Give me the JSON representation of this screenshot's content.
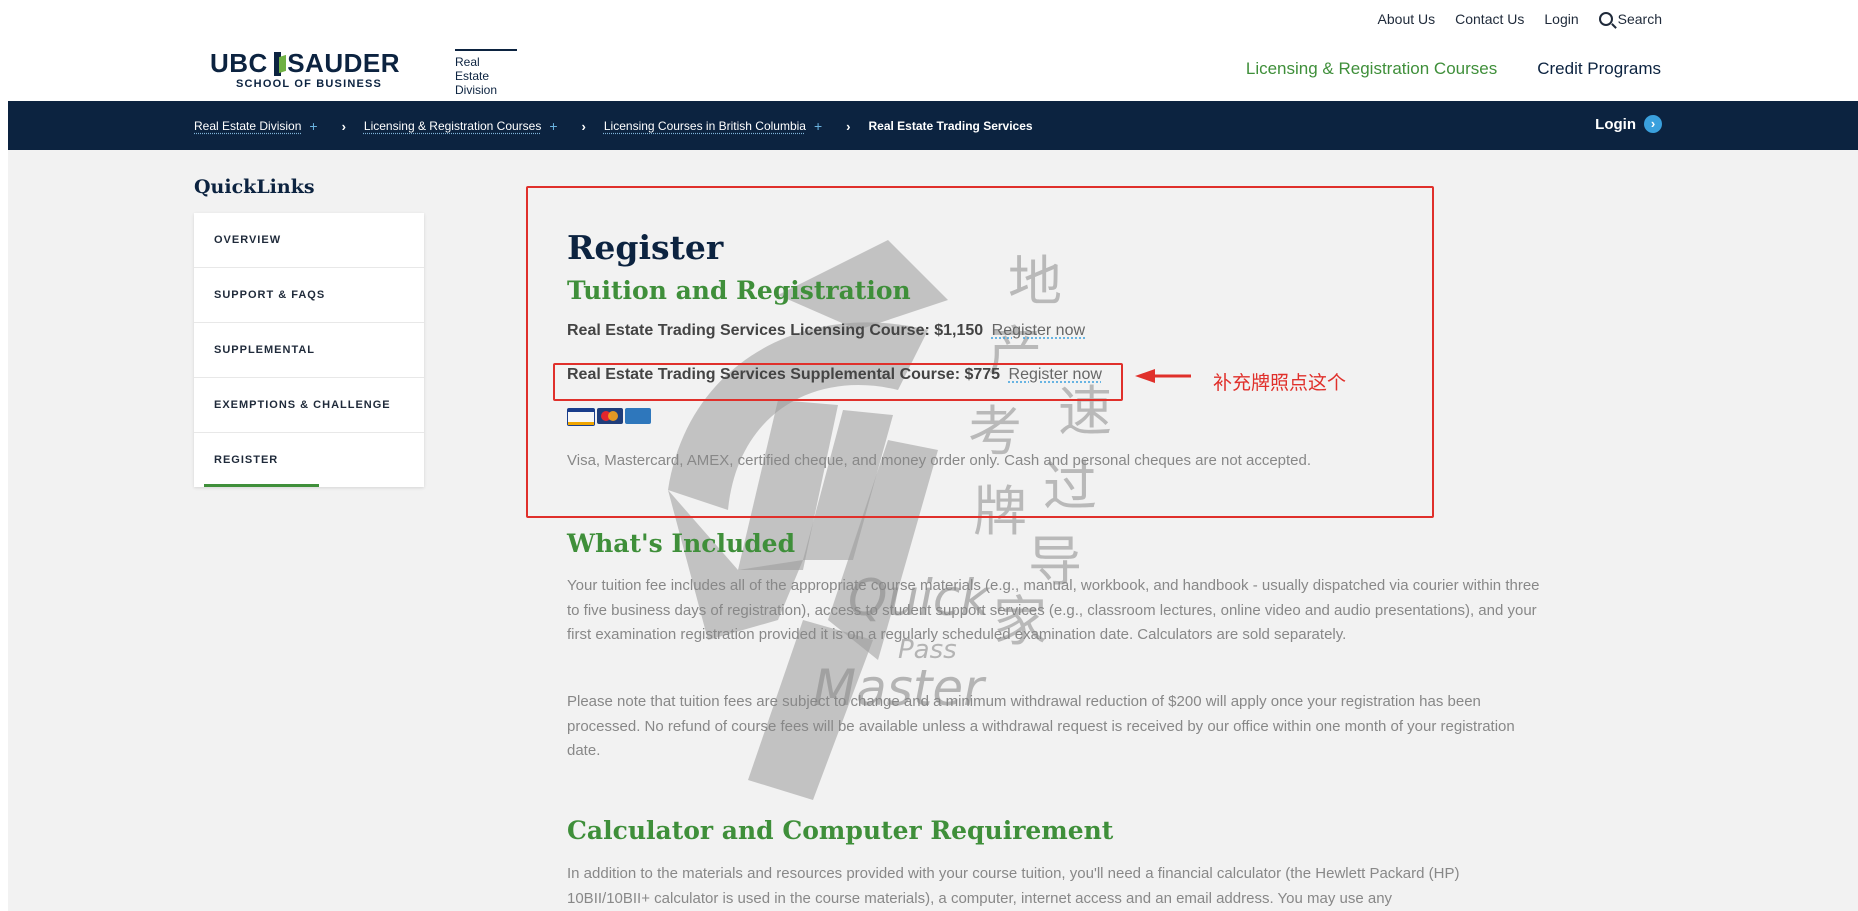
{
  "utility_links": {
    "about": "About Us",
    "contact": "Contact Us",
    "login": "Login",
    "search": "Search"
  },
  "logo": {
    "ubc": "UBC",
    "sauder": "SAUDER",
    "school": "SCHOOL OF BUSINESS",
    "division_line1": "Real Estate",
    "division_line2": "Division"
  },
  "main_nav": {
    "licensing": "Licensing & Registration Courses",
    "credit": "Credit Programs"
  },
  "breadcrumb": {
    "items": [
      "Real Estate Division",
      "Licensing & Registration Courses",
      "Licensing Courses in British Columbia"
    ],
    "current": "Real Estate Trading Services",
    "login": "Login"
  },
  "quicklinks": {
    "title": "QuickLinks",
    "items": [
      "OVERVIEW",
      "SUPPORT & FAQS",
      "SUPPLEMENTAL",
      "EXEMPTIONS & CHALLENGE",
      "REGISTER"
    ]
  },
  "content": {
    "register_heading": "Register",
    "tuition_heading": "Tuition and Registration",
    "licensing_course": "Real Estate Trading Services Licensing Course: $1,150",
    "supplemental_course": "Real Estate Trading Services Supplemental Course: $775",
    "register_now": "Register now",
    "payment_note": "Visa, Mastercard, AMEX, certified cheque, and money order only. Cash and personal cheques are not accepted.",
    "included_heading": "What's Included",
    "included_p1": "Your tuition fee includes all of the appropriate course materials (e.g., manual, workbook, and handbook - usually dispatched via courier within three to five business days of registration), access to student support services (e.g., classroom lectures, online video and audio presentations), and your first examination registration provided it is on a regularly scheduled examination date. Calculators are sold separately.",
    "included_p2": "Please note that tuition fees are subject to change and a minimum withdrawal reduction of $200 will apply once your registration has been processed. No refund of course fees will be available unless a withdrawal request is received by our office within one month of your registration date.",
    "calculator_heading": "Calculator and Computer Requirement",
    "calculator_p": "In addition to the materials and resources provided with your course tuition, you'll need a financial calculator (the Hewlett Packard (HP) 10BII/10BII+ calculator is used in the course materials), a computer, internet access and an email address. You may use any"
  },
  "payment_cards": [
    "visa",
    "mastercard",
    "amex"
  ],
  "annotation": {
    "text": "补充牌照点这个",
    "color": "#e0302b"
  },
  "watermark": {
    "chinese": [
      "地",
      "产",
      "考",
      "牌",
      "速",
      "过",
      "导",
      "家"
    ],
    "english": [
      "Quick",
      "Pass",
      "Master"
    ]
  },
  "colors": {
    "navy": "#0c2340",
    "green": "#3f8f3a",
    "light_blue": "#3aa0dd"
  }
}
